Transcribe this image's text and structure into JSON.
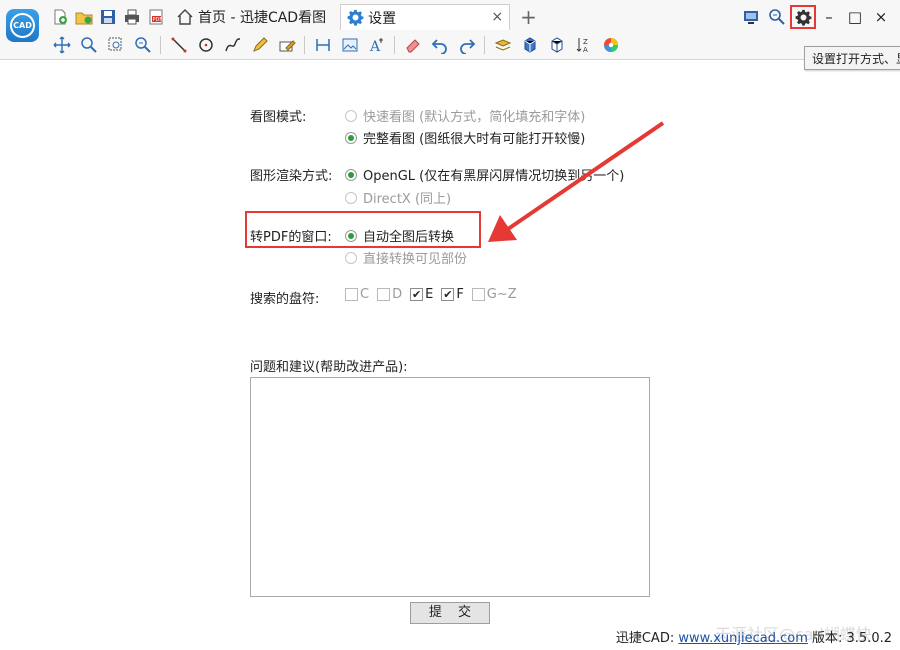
{
  "window": {
    "tabs": [
      {
        "label": "首页 - 迅捷CAD看图",
        "icon": "home-icon"
      },
      {
        "label": "设置",
        "icon": "gear-icon"
      }
    ],
    "close_tab_glyph": "×",
    "add_tab_glyph": "+",
    "controls": {
      "minimize": "–",
      "maximize": "□",
      "close": "×"
    },
    "settings_tooltip": "设置打开方式、显"
  },
  "settings": {
    "view_mode": {
      "label": "看图模式:",
      "options": [
        {
          "text": "快速看图 (默认方式，简化填充和字体)",
          "selected": false,
          "disabled": true
        },
        {
          "text": "完整看图 (图纸很大时有可能打开较慢)",
          "selected": true,
          "disabled": false
        }
      ]
    },
    "render_mode": {
      "label": "图形渲染方式:",
      "options": [
        {
          "text": "OpenGL (仅在有黑屏闪屏情况切换到另一个)",
          "selected": true,
          "disabled": false
        },
        {
          "text": "DirectX  (同上)",
          "selected": false,
          "disabled": true
        }
      ]
    },
    "pdf_window": {
      "label": "转PDF的窗口:",
      "options": [
        {
          "text": "自动全图后转换",
          "selected": true,
          "disabled": false
        },
        {
          "text": "直接转换可见部份",
          "selected": false,
          "disabled": true
        }
      ]
    },
    "search_drives": {
      "label": "搜索的盘符:",
      "drives": [
        {
          "label": "C",
          "checked": false
        },
        {
          "label": "D",
          "checked": false
        },
        {
          "label": "E",
          "checked": true
        },
        {
          "label": "F",
          "checked": true
        },
        {
          "label": "G~Z",
          "checked": false
        }
      ]
    },
    "feedback": {
      "label": "问题和建议(帮助改进产品):",
      "value": "",
      "submit_label": "提 交"
    }
  },
  "footer": {
    "brand": "迅捷CAD:",
    "url": "www.xunjiecad.com",
    "version": "版本: 3.5.0.2"
  },
  "watermark": "天涯社区@cad蝴蝶快",
  "colors": {
    "accent_red": "#e53935",
    "radio_green": "#2e9b3e",
    "link_blue": "#1a53a8"
  }
}
